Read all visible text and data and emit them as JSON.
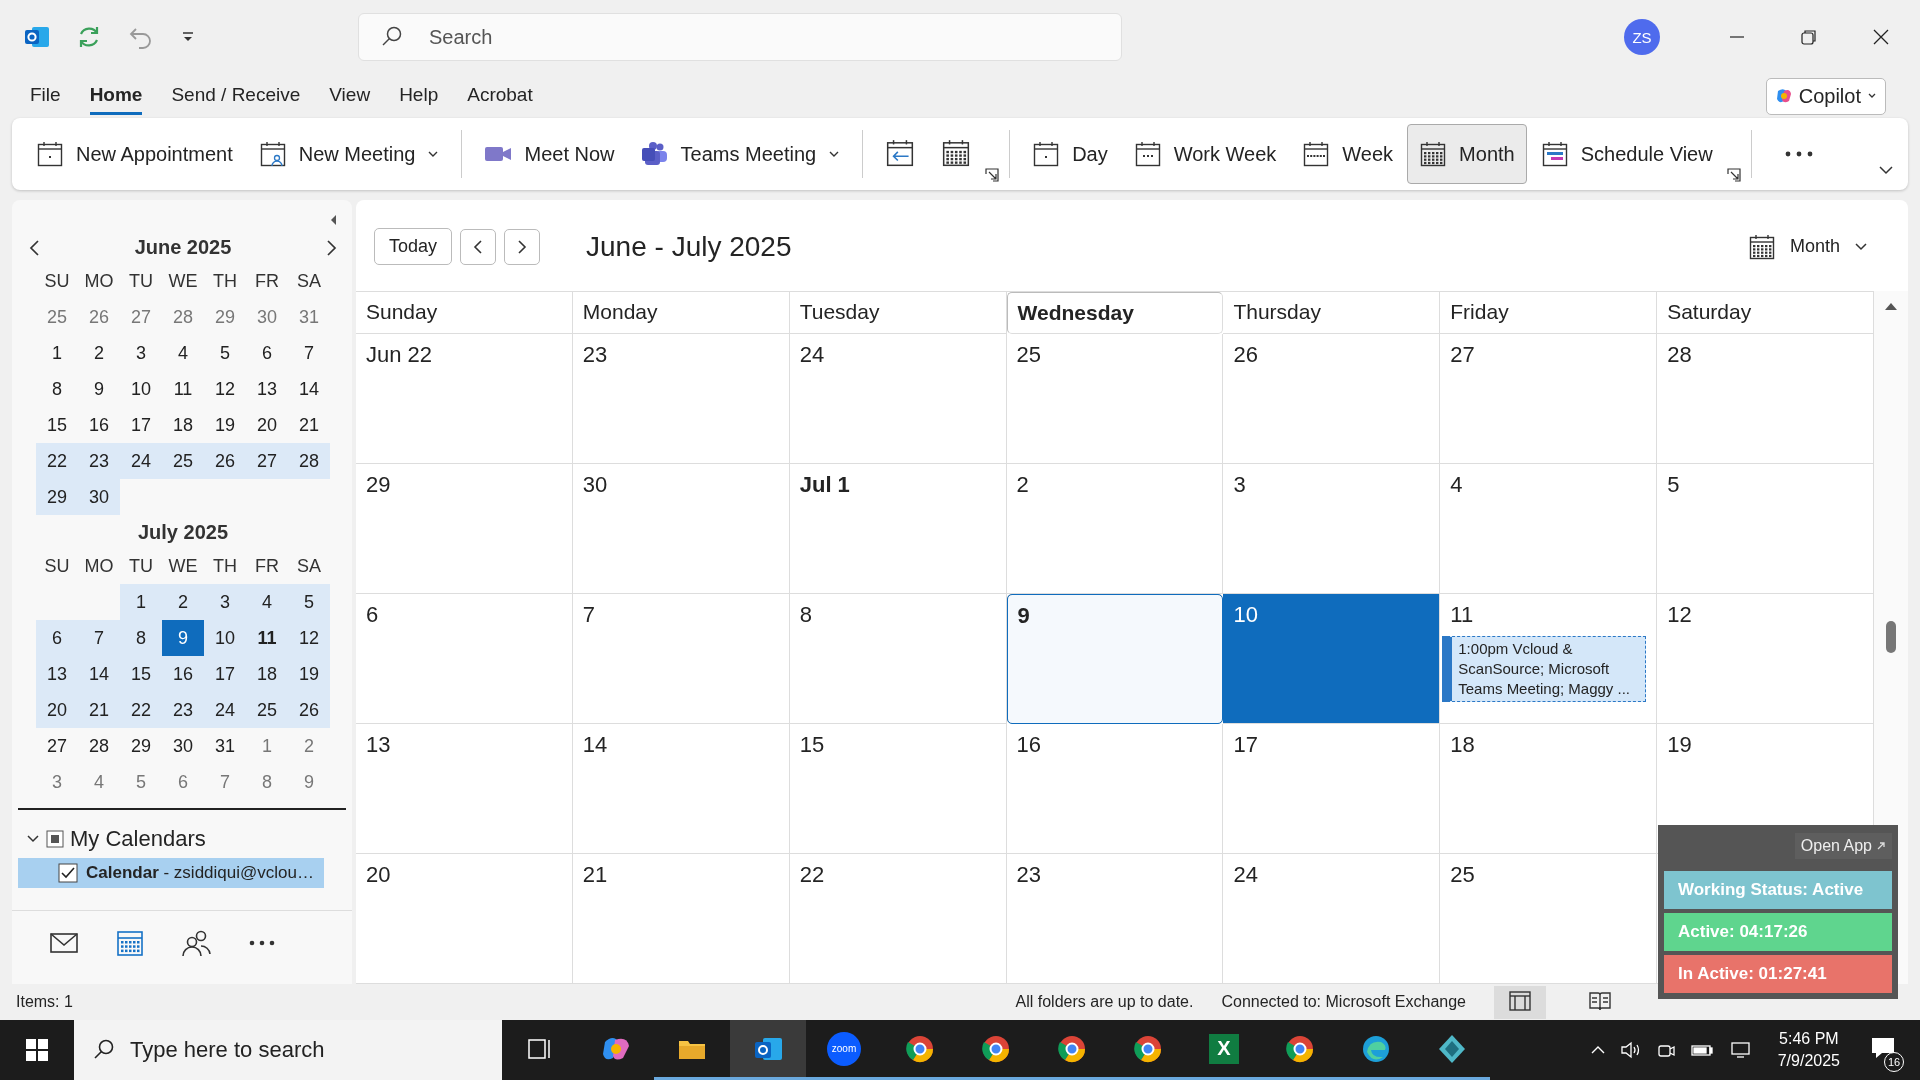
{
  "title_bar": {
    "search_placeholder": "Search",
    "avatar": "ZS"
  },
  "menu_tabs": [
    {
      "label": "File",
      "selected": false
    },
    {
      "label": "Home",
      "selected": true
    },
    {
      "label": "Send / Receive",
      "selected": false
    },
    {
      "label": "View",
      "selected": false
    },
    {
      "label": "Help",
      "selected": false
    },
    {
      "label": "Acrobat",
      "selected": false
    }
  ],
  "copilot": {
    "label": "Copilot"
  },
  "ribbon": [
    {
      "kind": "button",
      "label": "New Appointment",
      "dropdown": false,
      "selected": false
    },
    {
      "kind": "button",
      "label": "New Meeting",
      "dropdown": true,
      "selected": false
    },
    {
      "kind": "separator"
    },
    {
      "kind": "button",
      "label": "Meet Now",
      "dropdown": false,
      "selected": false
    },
    {
      "kind": "button",
      "label": "Teams Meeting",
      "dropdown": true,
      "selected": false
    },
    {
      "kind": "separator"
    },
    {
      "kind": "icon"
    },
    {
      "kind": "icon"
    },
    {
      "kind": "launcher"
    },
    {
      "kind": "separator"
    },
    {
      "kind": "button",
      "label": "Day",
      "dropdown": false,
      "selected": false
    },
    {
      "kind": "button",
      "label": "Work Week",
      "dropdown": false,
      "selected": false
    },
    {
      "kind": "button",
      "label": "Week",
      "dropdown": false,
      "selected": false
    },
    {
      "kind": "button",
      "label": "Month",
      "dropdown": false,
      "selected": true
    },
    {
      "kind": "button",
      "label": "Schedule View",
      "dropdown": false,
      "selected": false
    },
    {
      "kind": "launcher"
    },
    {
      "kind": "separator"
    },
    {
      "kind": "more"
    }
  ],
  "mini_calendars": [
    {
      "title": "June 2025",
      "weekdays": [
        "SU",
        "MO",
        "TU",
        "WE",
        "TH",
        "FR",
        "SA"
      ],
      "weeks": [
        [
          {
            "day": "25",
            "muted": true,
            "in_view": false,
            "selected": false,
            "has_items": false
          },
          {
            "day": "26",
            "muted": true,
            "in_view": false,
            "selected": false,
            "has_items": false
          },
          {
            "day": "27",
            "muted": true,
            "in_view": false,
            "selected": false,
            "has_items": false
          },
          {
            "day": "28",
            "muted": true,
            "in_view": false,
            "selected": false,
            "has_items": false
          },
          {
            "day": "29",
            "muted": true,
            "in_view": false,
            "selected": false,
            "has_items": false
          },
          {
            "day": "30",
            "muted": true,
            "in_view": false,
            "selected": false,
            "has_items": false
          },
          {
            "day": "31",
            "muted": true,
            "in_view": false,
            "selected": false,
            "has_items": false
          }
        ],
        [
          {
            "day": "1",
            "muted": false,
            "in_view": false,
            "selected": false,
            "has_items": false
          },
          {
            "day": "2",
            "muted": false,
            "in_view": false,
            "selected": false,
            "has_items": false
          },
          {
            "day": "3",
            "muted": false,
            "in_view": false,
            "selected": false,
            "has_items": false
          },
          {
            "day": "4",
            "muted": false,
            "in_view": false,
            "selected": false,
            "has_items": false
          },
          {
            "day": "5",
            "muted": false,
            "in_view": false,
            "selected": false,
            "has_items": false
          },
          {
            "day": "6",
            "muted": false,
            "in_view": false,
            "selected": false,
            "has_items": false
          },
          {
            "day": "7",
            "muted": false,
            "in_view": false,
            "selected": false,
            "has_items": false
          }
        ],
        [
          {
            "day": "8",
            "muted": false,
            "in_view": false,
            "selected": false,
            "has_items": false
          },
          {
            "day": "9",
            "muted": false,
            "in_view": false,
            "selected": false,
            "has_items": false
          },
          {
            "day": "10",
            "muted": false,
            "in_view": false,
            "selected": false,
            "has_items": false
          },
          {
            "day": "11",
            "muted": false,
            "in_view": false,
            "selected": false,
            "has_items": false
          },
          {
            "day": "12",
            "muted": false,
            "in_view": false,
            "selected": false,
            "has_items": false
          },
          {
            "day": "13",
            "muted": false,
            "in_view": false,
            "selected": false,
            "has_items": false
          },
          {
            "day": "14",
            "muted": false,
            "in_view": false,
            "selected": false,
            "has_items": false
          }
        ],
        [
          {
            "day": "15",
            "muted": false,
            "in_view": false,
            "selected": false,
            "has_items": false
          },
          {
            "day": "16",
            "muted": false,
            "in_view": false,
            "selected": false,
            "has_items": false
          },
          {
            "day": "17",
            "muted": false,
            "in_view": false,
            "selected": false,
            "has_items": false
          },
          {
            "day": "18",
            "muted": false,
            "in_view": false,
            "selected": false,
            "has_items": false
          },
          {
            "day": "19",
            "muted": false,
            "in_view": false,
            "selected": false,
            "has_items": false
          },
          {
            "day": "20",
            "muted": false,
            "in_view": false,
            "selected": false,
            "has_items": false
          },
          {
            "day": "21",
            "muted": false,
            "in_view": false,
            "selected": false,
            "has_items": false
          }
        ],
        [
          {
            "day": "22",
            "muted": false,
            "in_view": true,
            "selected": false,
            "has_items": false
          },
          {
            "day": "23",
            "muted": false,
            "in_view": true,
            "selected": false,
            "has_items": false
          },
          {
            "day": "24",
            "muted": false,
            "in_view": true,
            "selected": false,
            "has_items": false
          },
          {
            "day": "25",
            "muted": false,
            "in_view": true,
            "selected": false,
            "has_items": false
          },
          {
            "day": "26",
            "muted": false,
            "in_view": true,
            "selected": false,
            "has_items": false
          },
          {
            "day": "27",
            "muted": false,
            "in_view": true,
            "selected": false,
            "has_items": false
          },
          {
            "day": "28",
            "muted": false,
            "in_view": true,
            "selected": false,
            "has_items": false
          }
        ],
        [
          {
            "day": "29",
            "muted": false,
            "in_view": true,
            "selected": false,
            "has_items": false
          },
          {
            "day": "30",
            "muted": false,
            "in_view": true,
            "selected": false,
            "has_items": false
          }
        ]
      ]
    },
    {
      "title": "July 2025",
      "weekdays": [
        "SU",
        "MO",
        "TU",
        "WE",
        "TH",
        "FR",
        "SA"
      ],
      "weeks": [
        [
          {
            "day": "1",
            "muted": false,
            "in_view": true,
            "selected": false,
            "has_items": false
          },
          {
            "day": "2",
            "muted": false,
            "in_view": true,
            "selected": false,
            "has_items": false
          },
          {
            "day": "3",
            "muted": false,
            "in_view": true,
            "selected": false,
            "has_items": false
          },
          {
            "day": "4",
            "muted": false,
            "in_view": true,
            "selected": false,
            "has_items": false
          },
          {
            "day": "5",
            "muted": false,
            "in_view": true,
            "selected": false,
            "has_items": false
          }
        ],
        [
          {
            "day": "6",
            "muted": false,
            "in_view": true,
            "selected": false,
            "has_items": false
          },
          {
            "day": "7",
            "muted": false,
            "in_view": true,
            "selected": false,
            "has_items": false
          },
          {
            "day": "8",
            "muted": false,
            "in_view": true,
            "selected": false,
            "has_items": false
          },
          {
            "day": "9",
            "muted": false,
            "in_view": true,
            "selected": true,
            "has_items": false
          },
          {
            "day": "10",
            "muted": false,
            "in_view": true,
            "selected": false,
            "has_items": false
          },
          {
            "day": "11",
            "muted": false,
            "in_view": true,
            "selected": false,
            "has_items": true
          },
          {
            "day": "12",
            "muted": false,
            "in_view": true,
            "selected": false,
            "has_items": false
          }
        ],
        [
          {
            "day": "13",
            "muted": false,
            "in_view": true,
            "selected": false,
            "has_items": false
          },
          {
            "day": "14",
            "muted": false,
            "in_view": true,
            "selected": false,
            "has_items": false
          },
          {
            "day": "15",
            "muted": false,
            "in_view": true,
            "selected": false,
            "has_items": false
          },
          {
            "day": "16",
            "muted": false,
            "in_view": true,
            "selected": false,
            "has_items": false
          },
          {
            "day": "17",
            "muted": false,
            "in_view": true,
            "selected": false,
            "has_items": false
          },
          {
            "day": "18",
            "muted": false,
            "in_view": true,
            "selected": false,
            "has_items": false
          },
          {
            "day": "19",
            "muted": false,
            "in_view": true,
            "selected": false,
            "has_items": false
          }
        ],
        [
          {
            "day": "20",
            "muted": false,
            "in_view": true,
            "selected": false,
            "has_items": false
          },
          {
            "day": "21",
            "muted": false,
            "in_view": true,
            "selected": false,
            "has_items": false
          },
          {
            "day": "22",
            "muted": false,
            "in_view": true,
            "selected": false,
            "has_items": false
          },
          {
            "day": "23",
            "muted": false,
            "in_view": true,
            "selected": false,
            "has_items": false
          },
          {
            "day": "24",
            "muted": false,
            "in_view": true,
            "selected": false,
            "has_items": false
          },
          {
            "day": "25",
            "muted": false,
            "in_view": true,
            "selected": false,
            "has_items": false
          },
          {
            "day": "26",
            "muted": false,
            "in_view": true,
            "selected": false,
            "has_items": false
          }
        ],
        [
          {
            "day": "27",
            "muted": false,
            "in_view": false,
            "selected": false,
            "has_items": false
          },
          {
            "day": "28",
            "muted": false,
            "in_view": false,
            "selected": false,
            "has_items": false
          },
          {
            "day": "29",
            "muted": false,
            "in_view": false,
            "selected": false,
            "has_items": false
          },
          {
            "day": "30",
            "muted": false,
            "in_view": false,
            "selected": false,
            "has_items": false
          },
          {
            "day": "31",
            "muted": false,
            "in_view": false,
            "selected": false,
            "has_items": false
          },
          {
            "day": "1",
            "muted": true,
            "in_view": false,
            "selected": false,
            "has_items": false
          },
          {
            "day": "2",
            "muted": true,
            "in_view": false,
            "selected": false,
            "has_items": false
          }
        ],
        [
          {
            "day": "3",
            "muted": true,
            "in_view": false,
            "selected": false,
            "has_items": false
          },
          {
            "day": "4",
            "muted": true,
            "in_view": false,
            "selected": false,
            "has_items": false
          },
          {
            "day": "5",
            "muted": true,
            "in_view": false,
            "selected": false,
            "has_items": false
          },
          {
            "day": "6",
            "muted": true,
            "in_view": false,
            "selected": false,
            "has_items": false
          },
          {
            "day": "7",
            "muted": true,
            "in_view": false,
            "selected": false,
            "has_items": false
          },
          {
            "day": "8",
            "muted": true,
            "in_view": false,
            "selected": false,
            "has_items": false
          },
          {
            "day": "9",
            "muted": true,
            "in_view": false,
            "selected": false,
            "has_items": false
          }
        ]
      ]
    }
  ],
  "folders": {
    "group": {
      "label": "My Calendars",
      "expanded": true,
      "mixed": true
    },
    "items": [
      {
        "label": "**Calendar** - zsiddiqui@vclou…",
        "checked": true,
        "selected": true
      }
    ]
  },
  "nav": [
    {
      "selected": false
    },
    {
      "selected": true
    },
    {
      "selected": false
    },
    {
      "selected": false
    }
  ],
  "toolbar": {
    "today": "Today",
    "range": "June - July 2025",
    "view": "Month"
  },
  "weekdays": [
    {
      "label": "Sunday",
      "today": false
    },
    {
      "label": "Monday",
      "today": false
    },
    {
      "label": "Tuesday",
      "today": false
    },
    {
      "label": "Wednesday",
      "today": true
    },
    {
      "label": "Thursday",
      "today": false
    },
    {
      "label": "Friday",
      "today": false
    },
    {
      "label": "Saturday",
      "today": false
    }
  ],
  "weeks": [
    [
      {
        "label": "Jun 22",
        "today": false,
        "selected": false,
        "month_start": false
      },
      {
        "label": "23",
        "today": false,
        "selected": false,
        "month_start": false
      },
      {
        "label": "24",
        "today": false,
        "selected": false,
        "month_start": false
      },
      {
        "label": "25",
        "today": false,
        "selected": false,
        "month_start": false
      },
      {
        "label": "26",
        "today": false,
        "selected": false,
        "month_start": false
      },
      {
        "label": "27",
        "today": false,
        "selected": false,
        "month_start": false
      },
      {
        "label": "28",
        "today": false,
        "selected": false,
        "month_start": false
      }
    ],
    [
      {
        "label": "29",
        "today": false,
        "selected": false,
        "month_start": false
      },
      {
        "label": "30",
        "today": false,
        "selected": false,
        "month_start": false
      },
      {
        "label": "Jul 1",
        "today": false,
        "selected": false,
        "month_start": true
      },
      {
        "label": "2",
        "today": false,
        "selected": false,
        "month_start": false
      },
      {
        "label": "3",
        "today": false,
        "selected": false,
        "month_start": false
      },
      {
        "label": "4",
        "today": false,
        "selected": false,
        "month_start": false
      },
      {
        "label": "5",
        "today": false,
        "selected": false,
        "month_start": false
      }
    ],
    [
      {
        "label": "6",
        "today": false,
        "selected": false,
        "month_start": false
      },
      {
        "label": "7",
        "today": false,
        "selected": false,
        "month_start": false
      },
      {
        "label": "8",
        "today": false,
        "selected": false,
        "month_start": false
      },
      {
        "label": "9",
        "today": true,
        "selected": false,
        "month_start": false
      },
      {
        "label": "10",
        "today": false,
        "selected": true,
        "month_start": false
      },
      {
        "label": "11",
        "today": false,
        "selected": false,
        "month_start": false,
        "events": [
          {
            "text": "1:00pm Vcloud & ScanSource; Microsoft Teams Meeting; Maggy ...",
            "tentative": true
          }
        ]
      },
      {
        "label": "12",
        "today": false,
        "selected": false,
        "month_start": false
      }
    ],
    [
      {
        "label": "13",
        "today": false,
        "selected": false,
        "month_start": false
      },
      {
        "label": "14",
        "today": false,
        "selected": false,
        "month_start": false
      },
      {
        "label": "15",
        "today": false,
        "selected": false,
        "month_start": false
      },
      {
        "label": "16",
        "today": false,
        "selected": false,
        "month_start": false
      },
      {
        "label": "17",
        "today": false,
        "selected": false,
        "month_start": false
      },
      {
        "label": "18",
        "today": false,
        "selected": false,
        "month_start": false
      },
      {
        "label": "19",
        "today": false,
        "selected": false,
        "month_start": false
      }
    ],
    [
      {
        "label": "20",
        "today": false,
        "selected": false,
        "month_start": false
      },
      {
        "label": "21",
        "today": false,
        "selected": false,
        "month_start": false
      },
      {
        "label": "22",
        "today": false,
        "selected": false,
        "month_start": false
      },
      {
        "label": "23",
        "today": false,
        "selected": false,
        "month_start": false
      },
      {
        "label": "24",
        "today": false,
        "selected": false,
        "month_start": false
      },
      {
        "label": "25",
        "today": false,
        "selected": false,
        "month_start": false
      }
    ]
  ],
  "status_bar": {
    "items": "Items: 1",
    "sync": "All folders are up to date.",
    "connection": "Connected to: Microsoft Exchange",
    "views": [
      {
        "selected": true
      },
      {
        "selected": false
      }
    ]
  },
  "tracker": {
    "open_app": "Open App",
    "rows": [
      {
        "text": "Working Status: Active",
        "color": "#7ec4cf"
      },
      {
        "text": "Active: 04:17:26",
        "color": "#5fd58e"
      },
      {
        "text": "In Active: 01:27:41",
        "color": "#e8736a"
      }
    ]
  },
  "taskbar": {
    "search_placeholder": "Type here to search",
    "apps": [
      {
        "active": false,
        "running": false
      },
      {
        "active": false,
        "running": false
      },
      {
        "active": false,
        "running": true
      },
      {
        "active": true,
        "running": true
      },
      {
        "label": "zoom",
        "active": false,
        "running": true
      },
      {
        "active": false,
        "running": true
      },
      {
        "active": false,
        "running": true
      },
      {
        "active": false,
        "running": true
      },
      {
        "active": false,
        "running": true
      },
      {
        "label": "X",
        "active": false,
        "running": true
      },
      {
        "active": false,
        "running": true
      },
      {
        "active": false,
        "running": true
      },
      {
        "active": false,
        "running": true
      }
    ],
    "time": "5:46 PM",
    "date": "7/9/2025",
    "notifications": "16"
  }
}
